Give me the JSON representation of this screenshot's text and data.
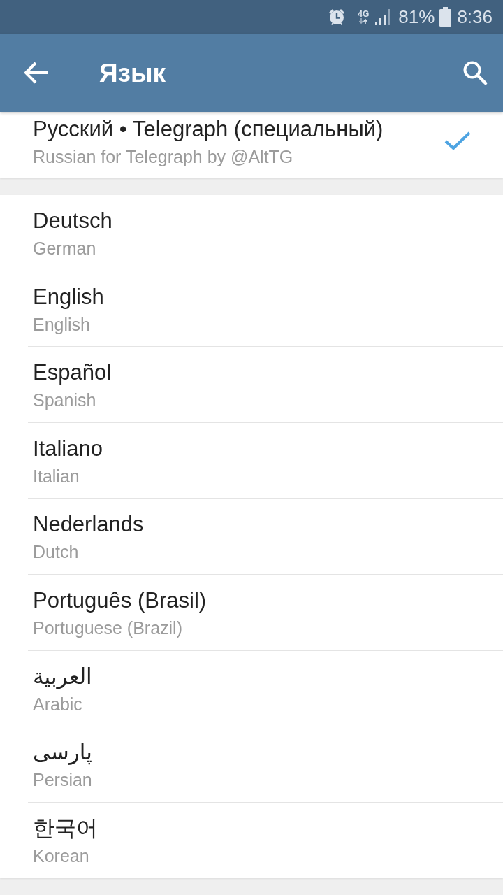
{
  "status_bar": {
    "network": "4G",
    "battery": "81%",
    "time": "8:36"
  },
  "app_bar": {
    "title": "Язык"
  },
  "sections": [
    {
      "items": [
        {
          "name": "Русский • Telegraph (специальный)",
          "description": "Russian for Telegraph by @AltTG",
          "selected": true
        }
      ]
    },
    {
      "items": [
        {
          "name": "Deutsch",
          "description": "German",
          "selected": false
        },
        {
          "name": "English",
          "description": "English",
          "selected": false
        },
        {
          "name": "Español",
          "description": "Spanish",
          "selected": false
        },
        {
          "name": "Italiano",
          "description": "Italian",
          "selected": false
        },
        {
          "name": "Nederlands",
          "description": "Dutch",
          "selected": false
        },
        {
          "name": "Português (Brasil)",
          "description": "Portuguese (Brazil)",
          "selected": false
        },
        {
          "name": "العربية",
          "description": "Arabic",
          "selected": false
        },
        {
          "name": "پارسی",
          "description": "Persian",
          "selected": false
        },
        {
          "name": "한국어",
          "description": "Korean",
          "selected": false
        }
      ]
    }
  ]
}
